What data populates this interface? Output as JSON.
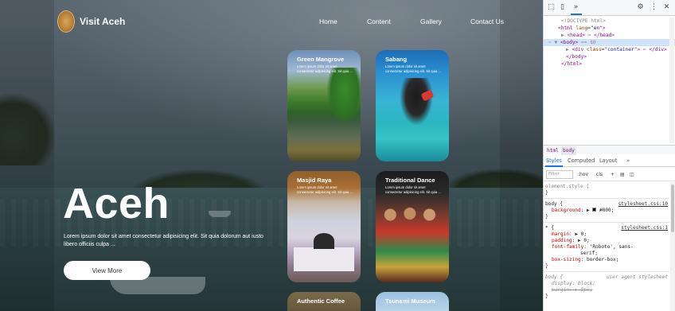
{
  "site": {
    "logo_text": "Visit Aceh",
    "nav": [
      "Home",
      "Content",
      "Gallery",
      "Contact Us"
    ],
    "hero_title": "Aceh",
    "hero_desc": "Lorem ipsum dolor sit amet consectetur adipisicing elit. Sit quia dolorum aut iusto libero officiis culpa ...",
    "hero_button": "View More",
    "cards": [
      {
        "title": "Green Mangrove",
        "desc": "Lorem ipsum dolor sit amet consectetur adipisicing elit. Sit quia ..."
      },
      {
        "title": "Sabang",
        "desc": "Lorem ipsum dolor sit amet consectetur adipisicing elit. Sit quia ..."
      },
      {
        "title": "Masjid Raya",
        "desc": "Lorem ipsum dolor sit amet consectetur adipisicing elit. Sit quia ..."
      },
      {
        "title": "Traditional Dance",
        "desc": "Lorem ipsum dolor sit amet consectetur adipisicing elit. Sit quia ..."
      },
      {
        "title": "Authentic Coffee",
        "desc": ""
      },
      {
        "title": "Tsunami Museum",
        "desc": ""
      }
    ]
  },
  "devtools": {
    "toolbar_more": "»",
    "settings_icon": "⚙",
    "menu_icon": "⋮",
    "close_icon": "✕",
    "dom": {
      "doctype": "<!DOCTYPE html>",
      "html_open_tag": "<html",
      "html_attr_name": "lang",
      "html_attr_val": "\"en\"",
      "head_line": "<head> ⋯ </head>",
      "body_open": "<body>",
      "body_marker": "== $0",
      "div_open": "<div",
      "div_attr_name": "class",
      "div_attr_val": "\"container\"",
      "div_rest": "> ⋯ </div>",
      "body_close": "</body>",
      "html_close": "</html>"
    },
    "crumbs": [
      "html",
      "body"
    ],
    "styles_tabs": [
      "Styles",
      "Computed",
      "Layout",
      "»"
    ],
    "filter_placeholder": "Filter",
    "filter_options": [
      ":hov",
      ".cls",
      "+"
    ],
    "rules": {
      "element_style": "element.style {",
      "close_brace": "}",
      "body_selector": "body {",
      "body_source": "stylesheet.css:10",
      "background_prop": "background",
      "background_val": "#000;",
      "star_selector": "* {",
      "star_source": "stylesheet.css:1",
      "margin_prop": "margin",
      "margin_val": "0;",
      "padding_prop": "padding",
      "padding_val": "0;",
      "font_prop": "font-family",
      "font_val": "'Roboto', sans-",
      "font_val_cont": "serif;",
      "box_prop": "box-sizing",
      "box_val": "border-box;",
      "ua_selector": "body {",
      "ua_label": "user agent stylesheet",
      "display_prop": "display",
      "display_val": "block;",
      "margin_ua": "margin: ▶ 8px;",
      "ua_close": "}"
    }
  }
}
